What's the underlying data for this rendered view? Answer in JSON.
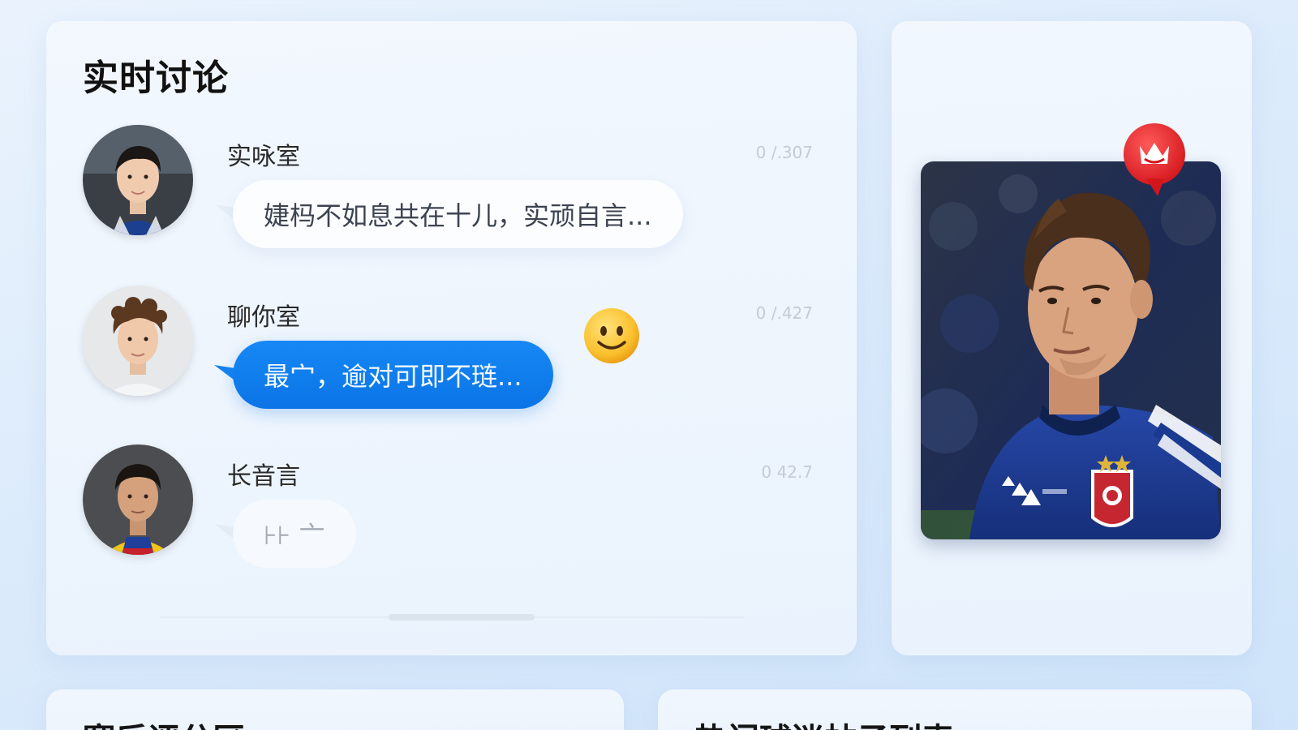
{
  "chat": {
    "title": "实时讨论",
    "messages": [
      {
        "user": "实咏室",
        "time": "0 /.307",
        "text": "婕杩不如息共在十儿，实顽自言...",
        "style": "white"
      },
      {
        "user": "聊你室",
        "time": "0 /.427",
        "text": "最宀，逾对可即不琏...",
        "style": "blue",
        "emoji": "smiley-emoji"
      },
      {
        "user": "长音言",
        "time": "0 42.7",
        "text": "⊦⊦ 亠",
        "style": "faded"
      }
    ]
  },
  "player": {
    "photo": "player-photo",
    "badge_icon": "crown-icon",
    "colors": {
      "jersey": "#1c3c8c",
      "badge": "#e8262c"
    }
  },
  "bottom": {
    "left_title": "赛后评分区",
    "right_title": "热门球迷帖子列表"
  },
  "colors": {
    "accent": "#0b74e6",
    "background": "#dcebfb"
  }
}
